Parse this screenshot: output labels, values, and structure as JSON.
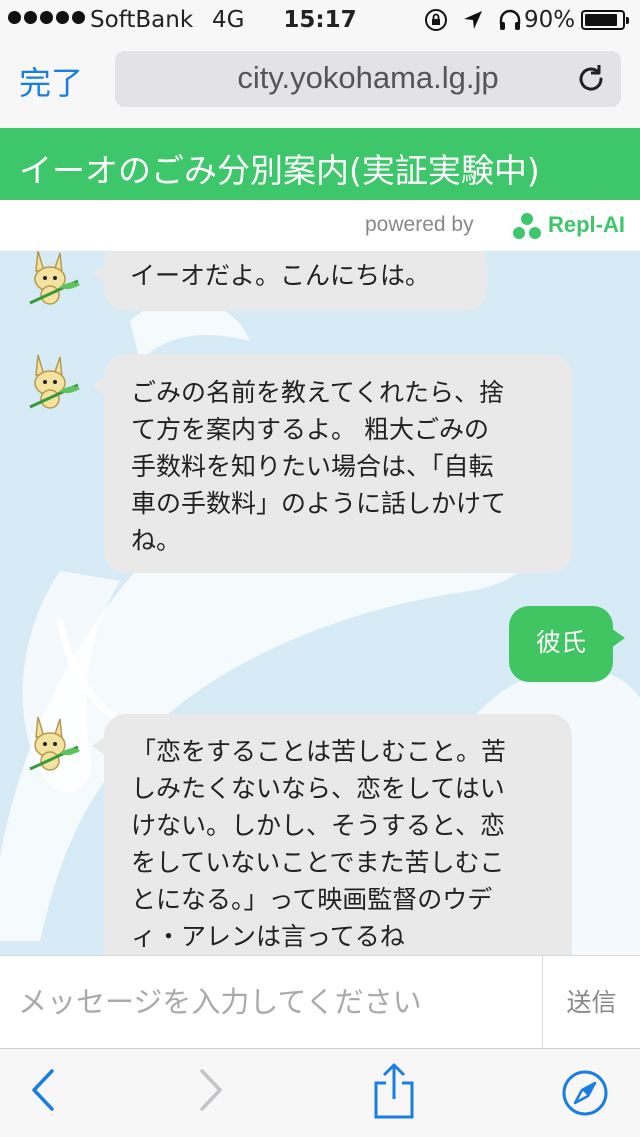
{
  "status_bar": {
    "carrier": "SoftBank",
    "network": "4G",
    "time": "15:17",
    "battery_percent": "90%",
    "battery_level": 0.9
  },
  "browser": {
    "done_label": "完了",
    "url": "city.yokohama.lg.jp"
  },
  "header": {
    "title": "イーオのごみ分別案内(実証実験中)",
    "powered_by": "powered by",
    "brand": "Repl-AI"
  },
  "messages": [
    {
      "sender": "bot",
      "lines": [
        "イーオだよ。こんにちは。"
      ]
    },
    {
      "sender": "bot",
      "lines": [
        "ごみの名前を教えてくれたら、捨",
        "て方を案内するよ。 粗大ごみの",
        "手数料を知りたい場合は、「自転",
        "車の手数料」のように話しかけて",
        "ね。"
      ]
    },
    {
      "sender": "user",
      "lines": [
        "彼氏"
      ]
    },
    {
      "sender": "bot",
      "lines": [
        "「恋をすることは苦しむこと。苦",
        "しみたくないなら、恋をしてはい",
        "けない。しかし、そうすると、恋",
        "をしていないことでまた苦しむこ",
        "とになる。」って映画監督のウデ",
        "ィ・アレンは言ってるね"
      ]
    }
  ],
  "input": {
    "placeholder": "メッセージを入力してください",
    "send_label": "送信"
  },
  "colors": {
    "accent_green": "#3ec66a",
    "link_blue": "#1a7ee0",
    "chat_background": "#d7ebf7"
  },
  "icons": [
    "reload-icon",
    "location-arrow-icon",
    "headphones-icon",
    "back-icon",
    "forward-icon",
    "share-icon",
    "compass-icon",
    "mascot-avatar"
  ]
}
